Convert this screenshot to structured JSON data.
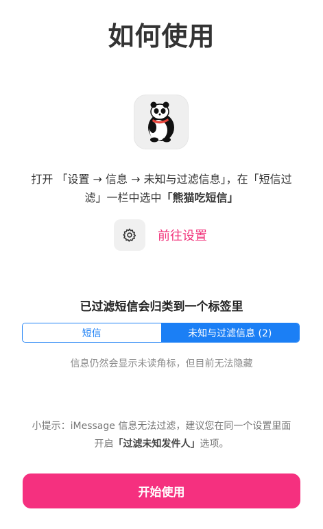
{
  "header": {
    "title": "如何使用"
  },
  "app_icon": {
    "icon": "panda-icon"
  },
  "instruction": {
    "line1": "打开 「设置 → 信息 → 未知与过滤信息」，在「短信过",
    "line2_prefix": "滤」一栏中选中",
    "line2_bold": "「熊猫吃短信」"
  },
  "settings_link": {
    "icon": "gear-icon",
    "label": "前往设置"
  },
  "filter_section": {
    "title": "已过滤短信会归类到一个标签里",
    "tabs": [
      {
        "label": "短信",
        "selected": false
      },
      {
        "label": "未知与过滤信息 (2)",
        "selected": true
      }
    ],
    "note": "信息仍然会显示未读角标，但目前无法隐藏"
  },
  "tip": {
    "line1": "小提示：iMessage 信息无法过滤，建议您在同一个设置里面",
    "line2_prefix": "开启",
    "line2_bold": "「过滤未知发件人」",
    "line2_suffix": "选项。"
  },
  "start_button": {
    "label": "开始使用"
  },
  "colors": {
    "accent_pink": "#f5307f",
    "link_pink": "#f1327a",
    "segment_blue": "#1b7ff5"
  }
}
